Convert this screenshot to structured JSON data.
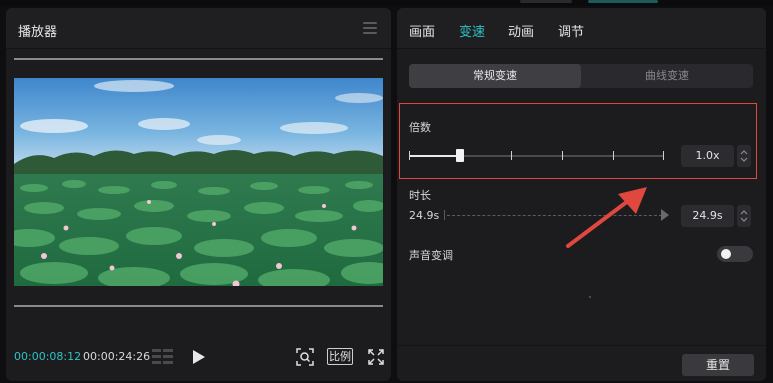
{
  "player": {
    "title": "播放器",
    "current_time": "00:00:08:12",
    "total_time": "00:00:24:26",
    "ratio_label": "比例"
  },
  "tabs": [
    {
      "label": "画面",
      "active": false
    },
    {
      "label": "变速",
      "active": true
    },
    {
      "label": "动画",
      "active": false
    },
    {
      "label": "调节",
      "active": false
    }
  ],
  "speed_mode": {
    "options": [
      "常规变速",
      "曲线变速"
    ],
    "selected": "常规变速"
  },
  "multiplier": {
    "label": "倍数",
    "value": "1.0x",
    "slider_fraction": 0.2
  },
  "duration": {
    "label": "时长",
    "original": "24.9s",
    "value": "24.9s"
  },
  "pitch": {
    "label": "声音变调",
    "enabled": false
  },
  "footer": {
    "reset_label": "重置"
  },
  "colors": {
    "accent": "#2ec2c2",
    "annotation": "#e0473e",
    "panel_bg": "#1c1c1f"
  }
}
